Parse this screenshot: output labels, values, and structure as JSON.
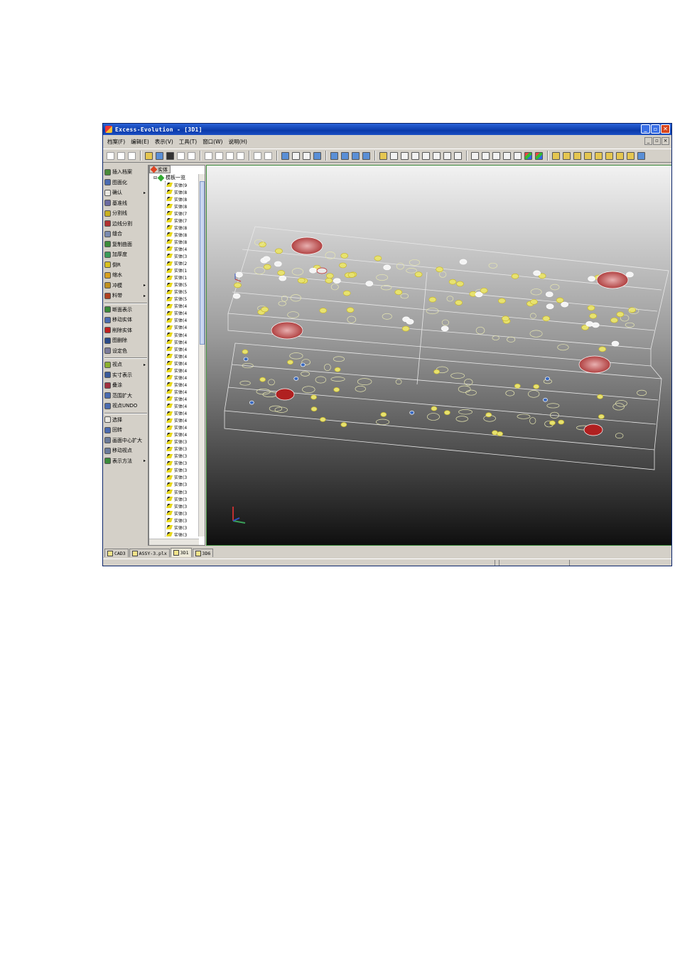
{
  "window": {
    "title": "Excess-Evolution - [3D1]"
  },
  "menu": [
    "档案(F)",
    "编辑(E)",
    "表示(V)",
    "工具(T)",
    "窗口(W)",
    "说明(H)"
  ],
  "left_panel": {
    "commands": [
      {
        "label": "插入档案",
        "color": "#4a8a3a",
        "arrow": false
      },
      {
        "label": "图面化",
        "color": "#4a6ab0",
        "arrow": false
      },
      {
        "label": "确认",
        "color": "#e8e6e0",
        "arrow": true
      },
      {
        "label": "基准线",
        "color": "#6a6aa0",
        "arrow": false
      },
      {
        "label": "分割线",
        "color": "#c8b020",
        "arrow": false
      },
      {
        "label": "边线分割",
        "color": "#b03030",
        "arrow": false
      },
      {
        "label": "缝合",
        "color": "#7a8ab0",
        "arrow": false
      },
      {
        "label": "复制曲面",
        "color": "#3a8a3a",
        "arrow": false
      },
      {
        "label": "加厚度",
        "color": "#3a9a5a",
        "arrow": false
      },
      {
        "label": "倒R",
        "color": "#d8c020",
        "arrow": false
      },
      {
        "label": "缩水",
        "color": "#d8a020",
        "arrow": false
      },
      {
        "label": "冲模",
        "color": "#c09020",
        "arrow": true
      },
      {
        "label": "料带",
        "color": "#b04020",
        "arrow": true
      },
      {
        "label": "断面表示",
        "color": "#3a8a3a",
        "arrow": false
      },
      {
        "label": "移动实体",
        "color": "#4a6ab0",
        "arrow": false
      },
      {
        "label": "削除实体",
        "color": "#c02020",
        "arrow": false
      },
      {
        "label": "图删除",
        "color": "#2a4a8a",
        "arrow": false
      },
      {
        "label": "设定色",
        "color": "#7a7a9a",
        "arrow": false
      },
      {
        "label": "视点",
        "color": "#8ab030",
        "arrow": true
      },
      {
        "label": "实寸表示",
        "color": "#3a5a9a",
        "arrow": false
      },
      {
        "label": "叠涂",
        "color": "#a03040",
        "arrow": false
      },
      {
        "label": "范围扩大",
        "color": "#4a6ab0",
        "arrow": false
      },
      {
        "label": "视点UNDO",
        "color": "#4a6ab0",
        "arrow": false
      },
      {
        "label": "选择",
        "color": "#e8e6e0",
        "arrow": false
      },
      {
        "label": "回转",
        "color": "#4a6ab0",
        "arrow": false
      },
      {
        "label": "画面中心扩大",
        "color": "#6a7a9a",
        "arrow": false
      },
      {
        "label": "移动视点",
        "color": "#6a7a9a",
        "arrow": false
      },
      {
        "label": "表示方法",
        "color": "#3a8a3a",
        "arrow": true
      }
    ]
  },
  "tree": {
    "tab_label": "实体",
    "root_label": "模板一览",
    "items": [
      "实体(9",
      "实体(8",
      "实体(8",
      "实体(8",
      "实体(7",
      "实体(7",
      "实体(8",
      "实体(8",
      "实体(8",
      "实体(4",
      "实体(3",
      "实体(2",
      "实体(1",
      "实体(1",
      "实体(5",
      "实体(5",
      "实体(5",
      "实体(4",
      "实体(4",
      "实体(4",
      "实体(4",
      "实体(4",
      "实体(4",
      "实体(4",
      "实体(4",
      "实体(4",
      "实体(4",
      "实体(4",
      "实体(4",
      "实体(4",
      "实体(4",
      "实体(4",
      "实体(4",
      "实体(4",
      "实体(4",
      "实体(4",
      "实体(3",
      "实体(3",
      "实体(3",
      "实体(3",
      "实体(3",
      "实体(3",
      "实体(3",
      "实体(3",
      "实体(3",
      "实体(3",
      "实体(3",
      "实体(3",
      "实体(3",
      "实体(3"
    ]
  },
  "doc_tabs": [
    {
      "label": "CAD3",
      "active": false
    },
    {
      "label": "ASSY-3.plx",
      "active": false
    },
    {
      "label": "3D1",
      "active": true
    },
    {
      "label": "3D6",
      "active": false
    }
  ]
}
